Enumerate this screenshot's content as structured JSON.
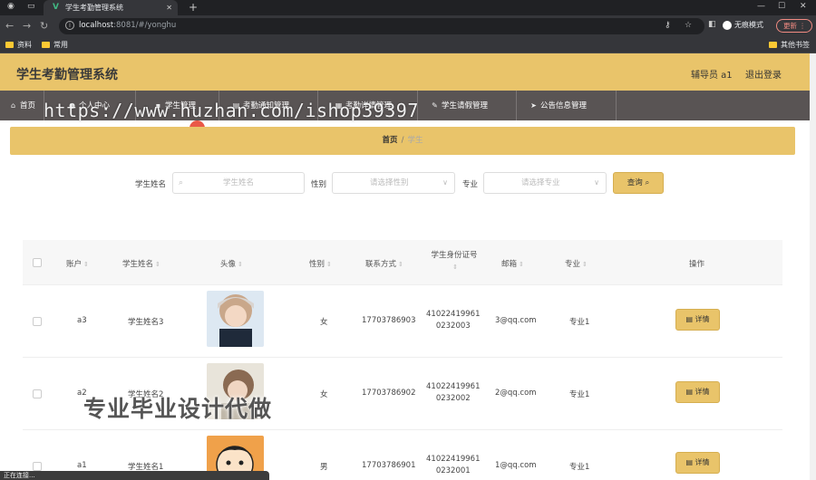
{
  "browser": {
    "tab_title": "学生考勤管理系统",
    "url_host": "localhost",
    "url_rest": ":8081/#/yonghu",
    "profile_label": "无痕模式",
    "update_label": "更新",
    "bookmarks": [
      "资料",
      "常用"
    ],
    "other_bookmarks": "其他书签"
  },
  "header": {
    "title": "学生考勤管理系统",
    "user": "辅导员 a1",
    "logout": "退出登录"
  },
  "nav": {
    "items": [
      {
        "label": "首页",
        "icon": "home-icon"
      },
      {
        "label": "个人中心",
        "icon": "user-icon"
      },
      {
        "label": "学生管理",
        "icon": "student-icon"
      },
      {
        "label": "考勤通知管理",
        "icon": "notice-icon"
      },
      {
        "label": "考勤详情管理",
        "icon": "detail-icon"
      },
      {
        "label": "学生请假管理",
        "icon": "leave-icon"
      },
      {
        "label": "公告信息管理",
        "icon": "announce-icon"
      }
    ]
  },
  "watermark": "https://www.huzhan.com/ishop39397",
  "breadcrumb": {
    "home": "首页",
    "sep": "/",
    "current": "学生"
  },
  "search": {
    "name_label": "学生姓名",
    "name_placeholder": "学生姓名",
    "gender_label": "性别",
    "gender_placeholder": "请选择性别",
    "major_label": "专业",
    "major_placeholder": "请选择专业",
    "query_label": "查询"
  },
  "table": {
    "headers": {
      "account": "账户",
      "name": "学生姓名",
      "avatar": "头像",
      "gender": "性别",
      "phone": "联系方式",
      "idcard_1": "学生身份证号",
      "email": "邮箱",
      "major": "专业",
      "action": "操作"
    },
    "detail_label": "详情",
    "rows": [
      {
        "account": "a3",
        "name": "学生姓名3",
        "gender": "女",
        "phone": "17703786903",
        "id1": "41022419961",
        "id2": "0232003",
        "email": "3@qq.com",
        "major": "专业1"
      },
      {
        "account": "a2",
        "name": "学生姓名2",
        "gender": "女",
        "phone": "17703786902",
        "id1": "41022419961",
        "id2": "0232002",
        "email": "2@qq.com",
        "major": "专业1"
      },
      {
        "account": "a1",
        "name": "学生姓名1",
        "gender": "男",
        "phone": "17703786901",
        "id1": "41022419961",
        "id2": "0232001",
        "email": "1@qq.com",
        "major": "专业1"
      }
    ]
  },
  "overlay_text": "专业毕业设计代做",
  "status_text": "正在连接...",
  "colors": {
    "accent": "#e9c46a",
    "nav_bg": "#595454"
  }
}
